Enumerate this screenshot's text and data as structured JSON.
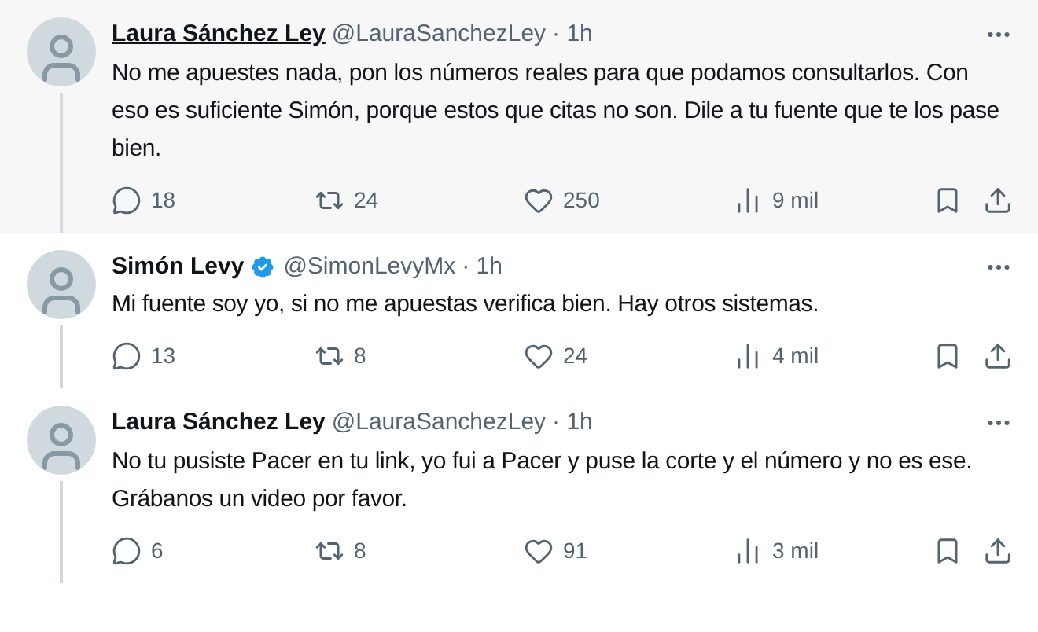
{
  "tweets": [
    {
      "name": "Laura Sánchez Ley",
      "verified": false,
      "handle": "@LauraSanchezLey",
      "time": "· 1h",
      "hovered": true,
      "text": "No me apuestes nada, pon los números reales para que podamos consultarlos. Con eso es suficiente Simón, porque estos que citas no son. Dile a tu fuente que te los pase bien.",
      "replies": "18",
      "reposts": "24",
      "likes": "250",
      "views": "9 mil"
    },
    {
      "name": "Simón Levy",
      "verified": true,
      "handle": "@SimonLevyMx",
      "time": "· 1h",
      "hovered": false,
      "text": "Mi fuente soy yo, si no me apuestas verifica bien. Hay otros sistemas.",
      "replies": "13",
      "reposts": "8",
      "likes": "24",
      "views": "4 mil"
    },
    {
      "name": "Laura Sánchez Ley",
      "verified": false,
      "handle": "@LauraSanchezLey",
      "time": "· 1h",
      "hovered": false,
      "text": "No tu pusiste Pacer en tu link, yo fui a Pacer y puse la corte y el número y no es ese. Grábanos un video por favor.",
      "replies": "6",
      "reposts": "8",
      "likes": "91",
      "views": "3 mil"
    }
  ]
}
